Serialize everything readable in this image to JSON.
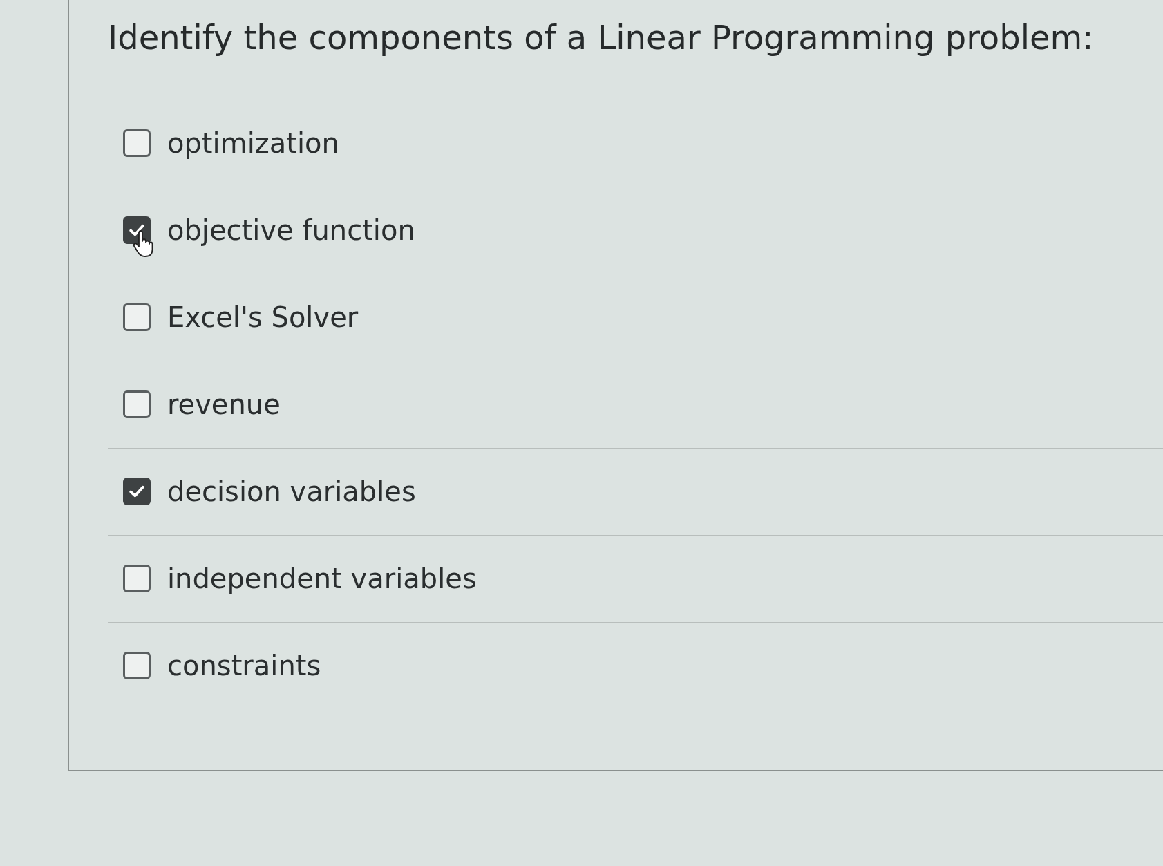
{
  "question": {
    "prompt": "Identify the components of a Linear Programming problem:",
    "options": [
      {
        "label": "optimization",
        "checked": false
      },
      {
        "label": "objective function",
        "checked": true
      },
      {
        "label": "Excel's Solver",
        "checked": false
      },
      {
        "label": "revenue",
        "checked": false
      },
      {
        "label": "decision variables",
        "checked": true
      },
      {
        "label": "independent variables",
        "checked": false
      },
      {
        "label": "constraints",
        "checked": false
      }
    ]
  }
}
